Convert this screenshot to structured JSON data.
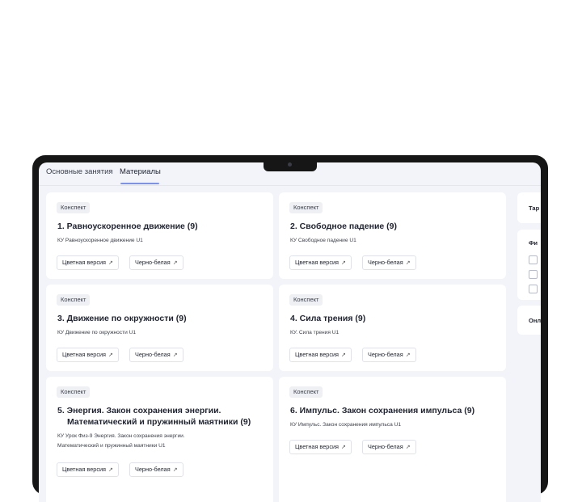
{
  "tabs": [
    {
      "label": "Основные занятия"
    },
    {
      "label": "Материалы"
    }
  ],
  "cards": [
    {
      "badge": "Конспект",
      "title": "1. Равноускоренное движение (9)",
      "desc": "КУ Равноускоренное движение U1",
      "btn_color": "Цветная версия",
      "btn_bw": "Черно-белая"
    },
    {
      "badge": "Конспект",
      "title": "2. Свободное падение (9)",
      "desc": "КУ Свободное падение U1",
      "btn_color": "Цветная версия",
      "btn_bw": "Черно-белая"
    },
    {
      "badge": "Конспект",
      "title": "3. Движение по окружности (9)",
      "desc": "КУ Движение по окружности U1",
      "btn_color": "Цветная версия",
      "btn_bw": "Черно-белая"
    },
    {
      "badge": "Конспект",
      "title": "4. Сила трения (9)",
      "desc": "КУ. Сила трения U1",
      "btn_color": "Цветная версия",
      "btn_bw": "Черно-белая"
    },
    {
      "badge": "Конспект",
      "title_line1": "5. Энергия. Закон сохранения энергии.",
      "title_line2": "Математический и пружинный маятники (9)",
      "desc_line1": "КУ Урок Физ-9 Энергия. Закон сохранения энергии.",
      "desc_line2": "Математический и пружинный маятники U1",
      "btn_color": "Цветная версия",
      "btn_bw": "Черно-белая"
    },
    {
      "badge": "Конспект",
      "title": "6. Импульс. Закон сохранения импульса (9)",
      "desc": "КУ Импульс. Закон сохранения импульса U1",
      "btn_color": "Цветная версия",
      "btn_bw": "Черно-белая"
    }
  ],
  "side": {
    "panel1_label": "Тар",
    "panel2_label": "Фи",
    "panel3_label": "Онл"
  },
  "colors": {
    "accent": "#7b92ee",
    "screen_bg": "#f2f4f9",
    "frame": "#161616"
  }
}
